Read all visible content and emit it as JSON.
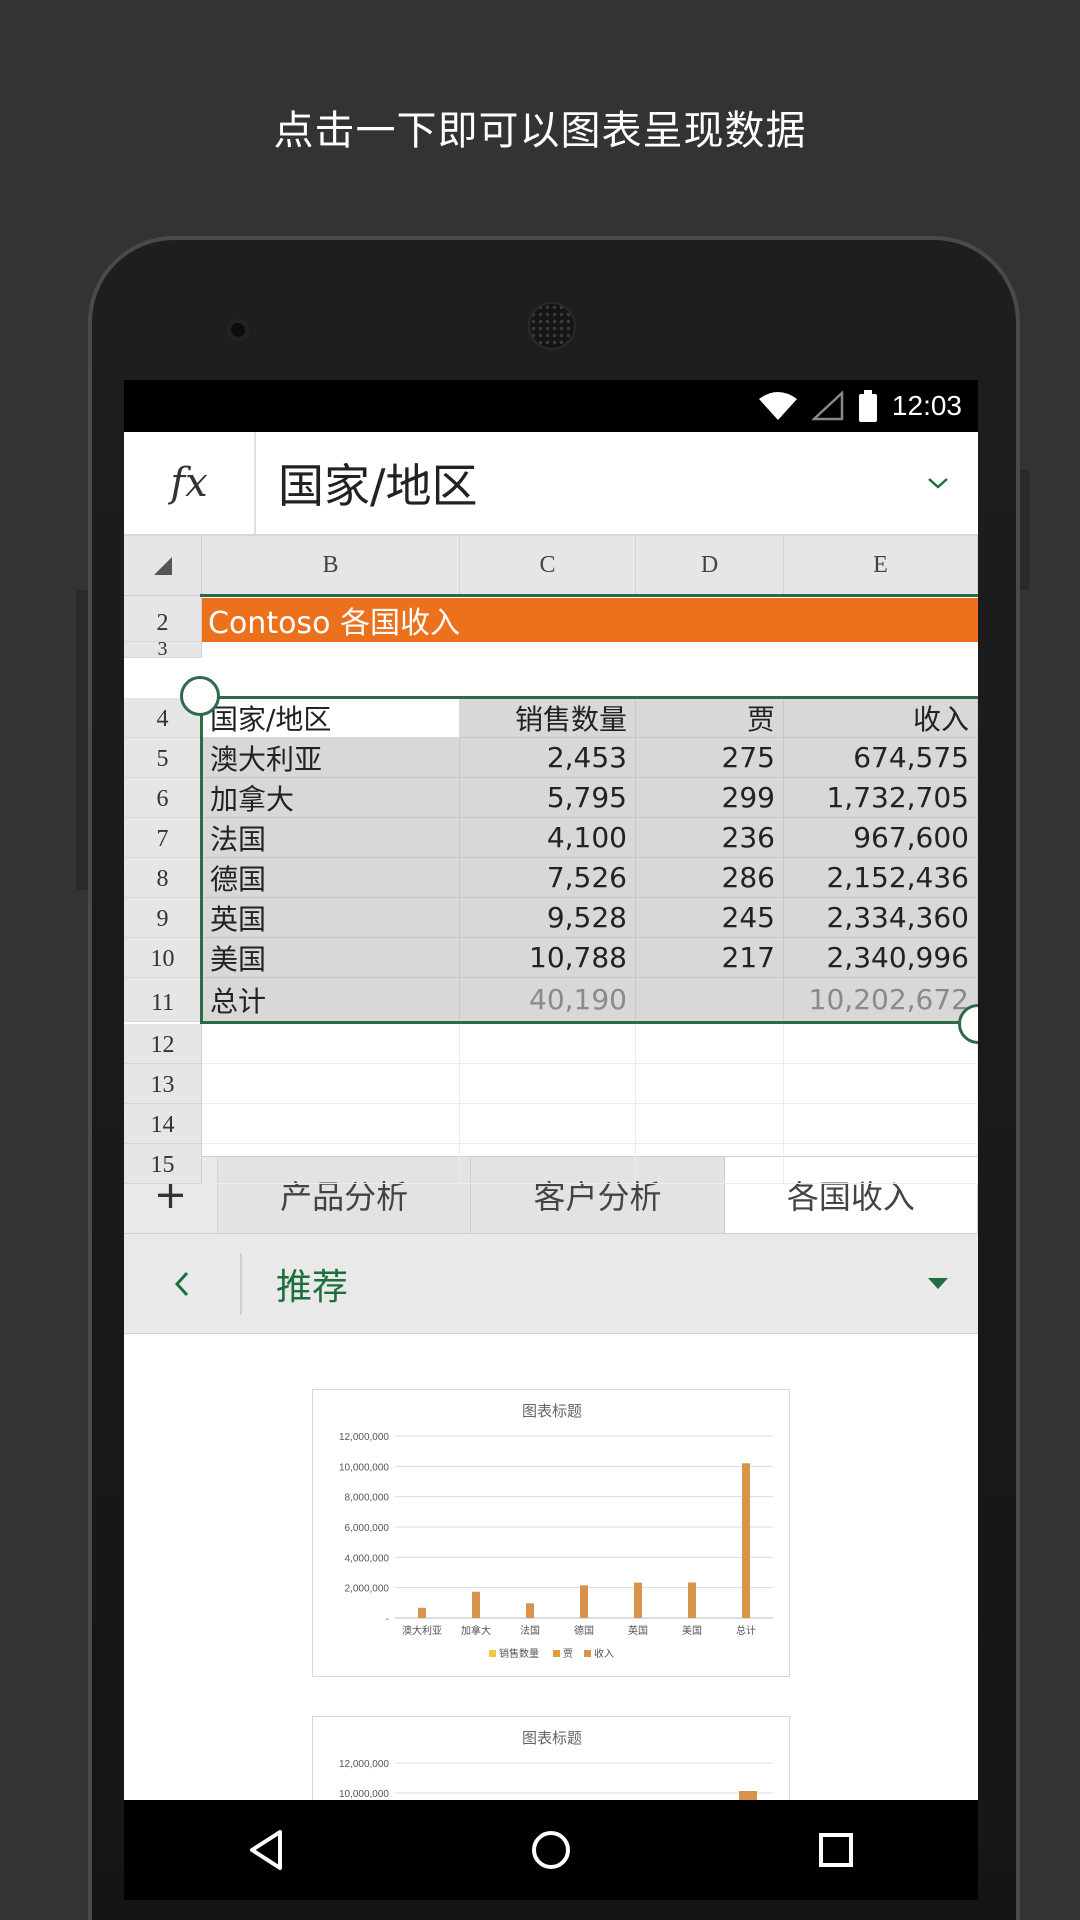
{
  "headline": "点击一下即可以图表呈现数据",
  "status": {
    "time": "12:03"
  },
  "formula_bar": {
    "fx_label": "fx",
    "value": "国家/地区"
  },
  "columns": [
    "B",
    "C",
    "D",
    "E"
  ],
  "sheet_title": "Contoso 各国收入",
  "table": {
    "headers": [
      "国家/地区",
      "销售数量",
      "贾",
      "收入"
    ],
    "rows": [
      {
        "row": "5",
        "country": "澳大利亚",
        "qty": "2,453",
        "price": "275",
        "revenue": "674,575"
      },
      {
        "row": "6",
        "country": "加拿大",
        "qty": "5,795",
        "price": "299",
        "revenue": "1,732,705"
      },
      {
        "row": "7",
        "country": "法国",
        "qty": "4,100",
        "price": "236",
        "revenue": "967,600"
      },
      {
        "row": "8",
        "country": "德国",
        "qty": "7,526",
        "price": "286",
        "revenue": "2,152,436"
      },
      {
        "row": "9",
        "country": "英国",
        "qty": "9,528",
        "price": "245",
        "revenue": "2,334,360"
      },
      {
        "row": "10",
        "country": "美国",
        "qty": "10,788",
        "price": "217",
        "revenue": "2,340,996"
      }
    ],
    "total": {
      "row": "11",
      "label": "总计",
      "qty": "40,190",
      "revenue": "10,202,672"
    }
  },
  "row_numbers": [
    "2",
    "3",
    "4",
    "12",
    "13",
    "14",
    "15"
  ],
  "sheet_tabs": {
    "add": "+",
    "tabs": [
      "产品分析",
      "客户分析",
      "各国收入"
    ],
    "active": 2
  },
  "recommend": {
    "title": "推荐"
  },
  "accent_orange": "#ec711c",
  "accent_green": "#1e6f3e",
  "chart_data": [
    {
      "type": "bar",
      "title": "图表标题",
      "categories": [
        "澳大利亚",
        "加拿大",
        "法国",
        "德国",
        "英国",
        "美国",
        "总计"
      ],
      "series": [
        {
          "name": "销售数量",
          "color": "#f2c744",
          "values": [
            2453,
            5795,
            4100,
            7526,
            9528,
            10788,
            40190
          ]
        },
        {
          "name": "贾",
          "color": "#e19a3c",
          "values": [
            275,
            299,
            236,
            286,
            245,
            217,
            0
          ]
        },
        {
          "name": "收入",
          "color": "#d8944a",
          "values": [
            674575,
            1732705,
            967600,
            2152436,
            2334360,
            2340996,
            10202672
          ]
        }
      ],
      "ylim": [
        0,
        12000000
      ],
      "yticks": [
        "12,000,000",
        "10,000,000",
        "8,000,000",
        "6,000,000",
        "4,000,000",
        "2,000,000",
        "-"
      ],
      "legend": "bottom"
    },
    {
      "type": "bar",
      "title": "图表标题",
      "yticks": [
        "12,000,000",
        "10,000,000"
      ]
    }
  ]
}
